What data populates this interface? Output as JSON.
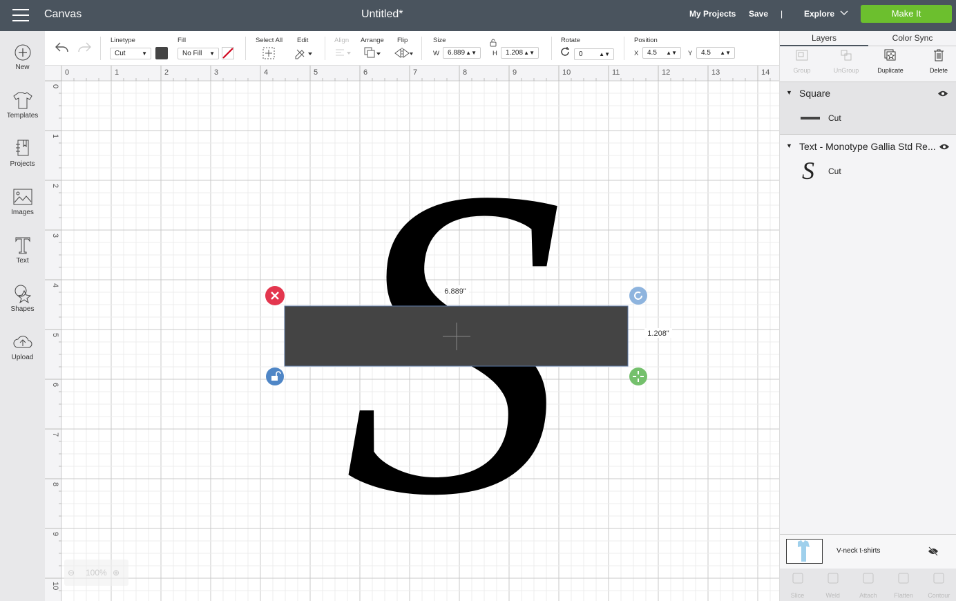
{
  "header": {
    "app": "Canvas",
    "title": "Untitled*",
    "my_projects": "My Projects",
    "save": "Save",
    "divider": "|",
    "explore": "Explore",
    "make_it": "Make It"
  },
  "sidebar": {
    "items": [
      {
        "label": "New",
        "icon": "plus-circle-icon"
      },
      {
        "label": "Templates",
        "icon": "tshirt-icon"
      },
      {
        "label": "Projects",
        "icon": "notebook-icon"
      },
      {
        "label": "Images",
        "icon": "image-icon"
      },
      {
        "label": "Text",
        "icon": "text-icon"
      },
      {
        "label": "Shapes",
        "icon": "shapes-icon"
      },
      {
        "label": "Upload",
        "icon": "cloud-upload-icon"
      }
    ]
  },
  "toolbar": {
    "linetype_label": "Linetype",
    "linetype": "Cut",
    "linetype_color": "#444444",
    "fill_label": "Fill",
    "fill": "No Fill",
    "select_all": "Select All",
    "edit": "Edit",
    "align": "Align",
    "arrange": "Arrange",
    "flip": "Flip",
    "size_label": "Size",
    "w_label": "W",
    "w": "6.889",
    "h_label": "H",
    "h": "1.208",
    "rotate_label": "Rotate",
    "rotate": "0",
    "position_label": "Position",
    "x_label": "X",
    "x": "4.5",
    "y_label": "Y",
    "y": "4.5"
  },
  "ruler": {
    "x": [
      "0",
      "1",
      "2",
      "3",
      "4",
      "5",
      "6",
      "7",
      "8",
      "9",
      "10",
      "11",
      "12",
      "13",
      "14"
    ],
    "y": [
      "0",
      "1",
      "2",
      "3",
      "4",
      "5",
      "6",
      "7",
      "8",
      "9",
      "10"
    ]
  },
  "canvas": {
    "width_readout": "6.889\"",
    "height_readout": "1.208\"",
    "glyph": "S",
    "zoom": "100%",
    "rect_color": "#444444"
  },
  "panel": {
    "tabs": [
      "Layers",
      "Color Sync"
    ],
    "tools": [
      {
        "label": "Group",
        "enabled": false
      },
      {
        "label": "UnGroup",
        "enabled": false
      },
      {
        "label": "Duplicate",
        "enabled": true
      },
      {
        "label": "Delete",
        "enabled": true
      }
    ],
    "layers": [
      {
        "name": "Square",
        "op": "Cut"
      },
      {
        "name": "Text - Monotype Gallia Std Re...",
        "op": "Cut",
        "thumb": "S"
      }
    ],
    "mat": {
      "label": "V-neck t-shirts"
    },
    "bottom_tools": [
      "Slice",
      "Weld",
      "Attach",
      "Flatten",
      "Contour"
    ]
  }
}
